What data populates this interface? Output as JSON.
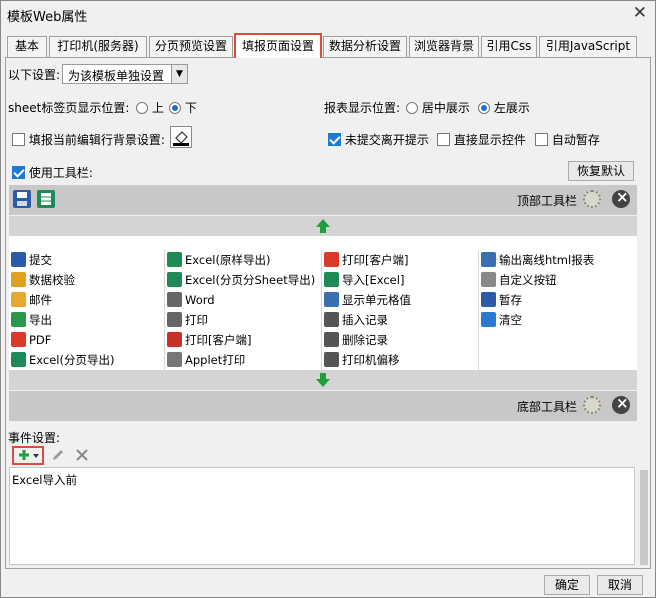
{
  "window": {
    "title": "模板Web属性"
  },
  "tabs": [
    {
      "label": "基本"
    },
    {
      "label": "打印机(服务器)"
    },
    {
      "label": "分页预览设置"
    },
    {
      "label": "填报页面设置"
    },
    {
      "label": "数据分析设置"
    },
    {
      "label": "浏览器背景"
    },
    {
      "label": "引用Css"
    },
    {
      "label": "引用JavaScript"
    }
  ],
  "settings": {
    "scope_label": "以下设置:",
    "scope_value": "为该模板单独设置",
    "sheet_tab_label": "sheet标签页显示位置:",
    "sheet_opt_top": "上",
    "sheet_opt_bottom": "下",
    "report_pos_label": "报表显示位置:",
    "report_opt_center": "居中展示",
    "report_opt_left": "左展示",
    "fill_row_bg_label": "填报当前编辑行背景设置:",
    "unsubmitted_label": "未提交离开提示",
    "direct_show_label": "直接显示控件",
    "autosave_label": "自动暂存",
    "use_toolbar_label": "使用工具栏:",
    "restore_default": "恢复默认"
  },
  "toolbar": {
    "top_label": "顶部工具栏",
    "bottom_label": "底部工具栏"
  },
  "buttons_grid": [
    [
      {
        "label": "提交",
        "icon": "submit-icon",
        "color": "#2a5aa8"
      },
      {
        "label": "Excel(原样导出)",
        "icon": "excel-icon",
        "color": "#1e8a55"
      },
      {
        "label": "打印[客户端]",
        "icon": "pdf-print-icon",
        "color": "#d93a2a"
      },
      {
        "label": "输出离线html报表",
        "icon": "html-export-icon",
        "color": "#3a6fb0"
      }
    ],
    [
      {
        "label": "数据校验",
        "icon": "pencil-check-icon",
        "color": "#e0a020"
      },
      {
        "label": "Excel(分页分Sheet导出)",
        "icon": "excel-icon",
        "color": "#1e8a55"
      },
      {
        "label": "导入[Excel]",
        "icon": "excel-import-icon",
        "color": "#1e8a55"
      },
      {
        "label": "自定义按钮",
        "icon": "gear-icon",
        "color": "#888888"
      }
    ],
    [
      {
        "label": "邮件",
        "icon": "mail-icon",
        "color": "#e8a830"
      },
      {
        "label": "Word",
        "icon": "word-icon",
        "color": "#666666"
      },
      {
        "label": "显示单元格值",
        "icon": "cell-value-icon",
        "color": "#3a6fb0"
      },
      {
        "label": "暂存",
        "icon": "save-icon",
        "color": "#2a5aa8"
      }
    ],
    [
      {
        "label": "导出",
        "icon": "export-icon",
        "color": "#2a9a4a"
      },
      {
        "label": "打印",
        "icon": "print-icon",
        "color": "#666666"
      },
      {
        "label": "插入记录",
        "icon": "insert-record-icon",
        "color": "#555555"
      },
      {
        "label": "清空",
        "icon": "eraser-icon",
        "color": "#2a7ad0"
      }
    ],
    [
      {
        "label": "PDF",
        "icon": "pdf-icon",
        "color": "#d93a2a"
      },
      {
        "label": "打印[客户端]",
        "icon": "flash-print-icon",
        "color": "#c8302a"
      },
      {
        "label": "删除记录",
        "icon": "delete-record-icon",
        "color": "#555555"
      },
      {
        "label": "",
        "icon": "",
        "color": ""
      }
    ],
    [
      {
        "label": "Excel(分页导出)",
        "icon": "excel-icon",
        "color": "#1e8a55"
      },
      {
        "label": "Applet打印",
        "icon": "applet-print-icon",
        "color": "#777777"
      },
      {
        "label": "打印机偏移",
        "icon": "move-icon",
        "color": "#555555"
      },
      {
        "label": "",
        "icon": "",
        "color": ""
      }
    ]
  ],
  "events": {
    "label": "事件设置:",
    "items": [
      "Excel导入前"
    ]
  },
  "footer": {
    "ok": "确定",
    "cancel": "取消"
  },
  "colors": {
    "accent": "#1f7ad1",
    "highlight": "#e04a3c",
    "arrow_green": "#1fa03a"
  }
}
